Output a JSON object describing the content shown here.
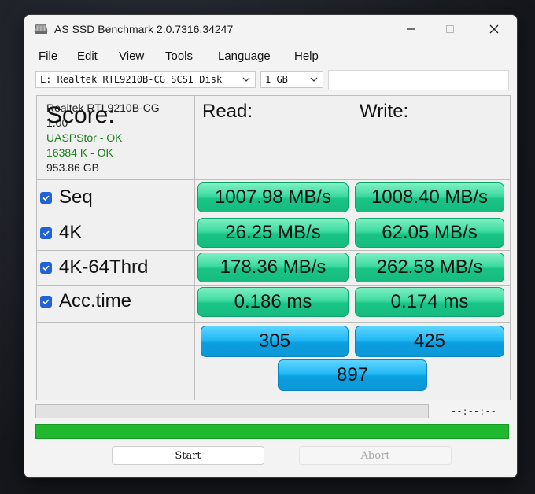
{
  "window": {
    "title": "AS SSD Benchmark 2.0.7316.34247"
  },
  "menu": {
    "items": [
      "File",
      "Edit",
      "View",
      "Tools",
      "Language",
      "Help"
    ]
  },
  "toolbar": {
    "drive_select": "L: Realtek RTL9210B-CG SCSI Disk",
    "size_select": "1 GB",
    "text_value": ""
  },
  "device": {
    "name": "Realtek RTL9210B-CG",
    "firmware": "1.00",
    "driver_status": "UASPStor - OK",
    "alignment_status": "16384 K - OK",
    "capacity": "953.86 GB"
  },
  "columns": {
    "read": "Read:",
    "write": "Write:"
  },
  "tests": [
    {
      "label": "Seq",
      "checked": true,
      "read": "1007.98 MB/s",
      "write": "1008.40 MB/s"
    },
    {
      "label": "4K",
      "checked": true,
      "read": "26.25 MB/s",
      "write": "62.05 MB/s"
    },
    {
      "label": "4K-64Thrd",
      "checked": true,
      "read": "178.36 MB/s",
      "write": "262.58 MB/s"
    },
    {
      "label": "Acc.time",
      "checked": true,
      "read": "0.186 ms",
      "write": "0.174 ms"
    }
  ],
  "score": {
    "label": "Score:",
    "read": "305",
    "write": "425",
    "total": "897"
  },
  "progress": {
    "time_text": "--:--:--",
    "fill_fraction": 0,
    "complete_fraction": 1
  },
  "buttons": {
    "start": "Start",
    "abort": "Abort"
  },
  "colors": {
    "result_green": "#19c487",
    "score_blue": "#0c9ee0",
    "progress_green": "#1fb82f",
    "status_ok": "#1e7f1e",
    "checkbox_blue": "#1f63d6"
  }
}
